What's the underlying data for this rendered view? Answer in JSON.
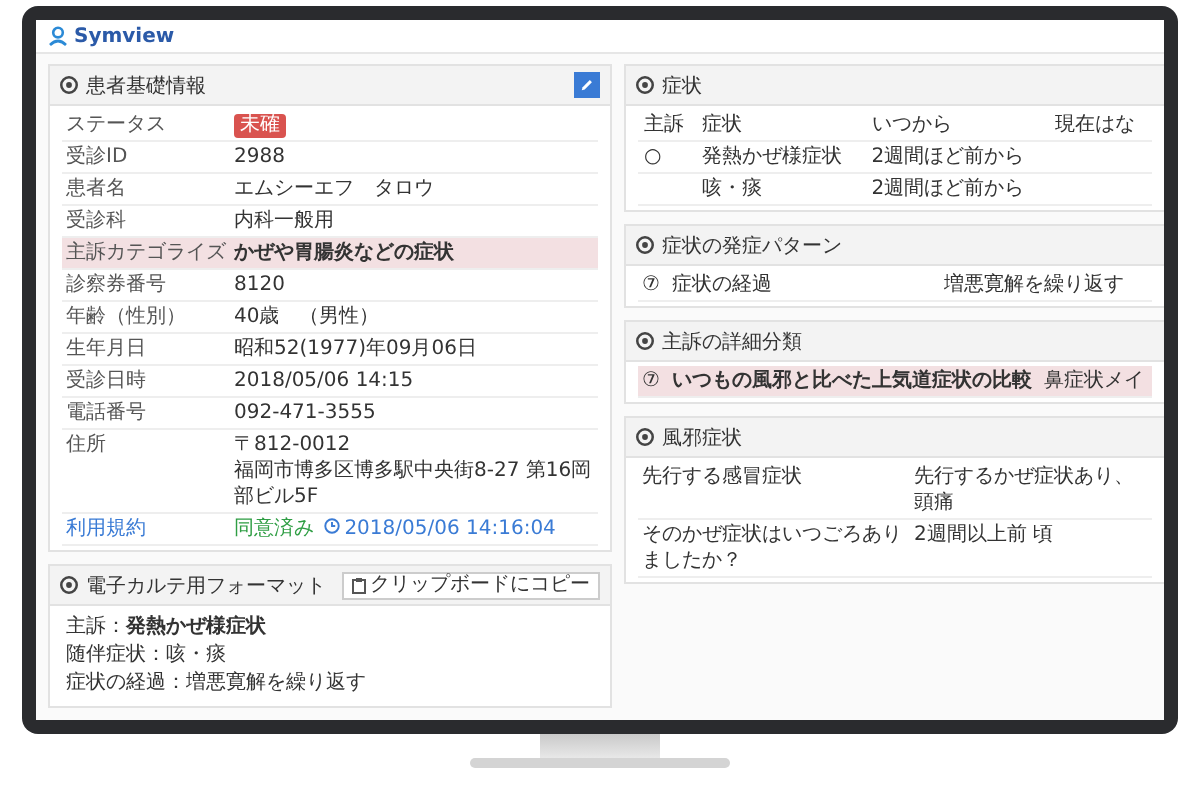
{
  "app": {
    "logo": "Symview"
  },
  "patient_panel": {
    "title": "患者基礎情報",
    "rows": [
      {
        "kind": "badge",
        "label": "ステータス",
        "value": "未確"
      },
      {
        "kind": "text",
        "label": "受診ID",
        "value": "2988"
      },
      {
        "kind": "text",
        "label": "患者名",
        "value": "エムシーエフ　タロウ"
      },
      {
        "kind": "text",
        "label": "受診科",
        "value": "内科一般用"
      },
      {
        "kind": "highlight",
        "label": "主訴カテゴライズ",
        "value": "かぜや胃腸炎などの症状"
      },
      {
        "kind": "text",
        "label": "診察券番号",
        "value": "8120"
      },
      {
        "kind": "text",
        "label": "年齢（性別）",
        "value": "40歳　（男性）"
      },
      {
        "kind": "text",
        "label": "生年月日",
        "value": "昭和52(1977)年09月06日"
      },
      {
        "kind": "text",
        "label": "受診日時",
        "value": "2018/05/06 14:15"
      },
      {
        "kind": "text",
        "label": "電話番号",
        "value": "092-471-3555"
      },
      {
        "kind": "address",
        "label": "住所",
        "lines": [
          "〒812-0012",
          "福岡市博多区博多駅中央街8-27 第16岡部ビル5F"
        ]
      },
      {
        "kind": "consent",
        "label": "利用規約",
        "value": "同意済み",
        "time": "2018/05/06 14:16:04"
      }
    ]
  },
  "format_panel": {
    "title": "電子カルテ用フォーマット",
    "copy_button": "クリップボードにコピー",
    "lines": [
      {
        "label": "主訴：",
        "value": "発熱かぜ様症状",
        "bold": true
      },
      {
        "label": "随伴症状：",
        "value": "咳・痰",
        "bold": false
      },
      {
        "label": "症状の経過：",
        "value": "増悪寛解を繰り返す",
        "bold": false
      }
    ]
  },
  "sections": [
    {
      "kind": "table",
      "title": "症状",
      "columns": [
        "主訴",
        "症状",
        "いつから",
        "現在はな"
      ],
      "rows": [
        {
          "cells": [
            "○",
            "発熱かぜ様症状",
            "2週間ほど前から"
          ]
        },
        {
          "cells": [
            "",
            "咳・痰",
            "2週間ほど前から"
          ]
        }
      ]
    },
    {
      "kind": "pairs",
      "title": "症状の発症パターン",
      "rows": [
        {
          "mark": "⑦",
          "label": "症状の経過",
          "value": "増悪寛解を繰り返す",
          "highlighted": false
        }
      ]
    },
    {
      "kind": "pairs",
      "title": "主訴の詳細分類",
      "rows": [
        {
          "mark": "⑦",
          "label": "いつもの風邪と比べた上気道症状の比較",
          "value": "鼻症状メイ",
          "highlighted": true
        }
      ]
    },
    {
      "kind": "pairs",
      "title": "風邪症状",
      "rows": [
        {
          "mark": "",
          "label": "先行する感冒症状",
          "value": "先行するかぜ症状あり、頭痛",
          "highlighted": false
        },
        {
          "mark": "",
          "label": "そのかぜ症状はいつごろありましたか？",
          "value": "2週間以上前 頃",
          "highlighted": false
        }
      ]
    }
  ]
}
